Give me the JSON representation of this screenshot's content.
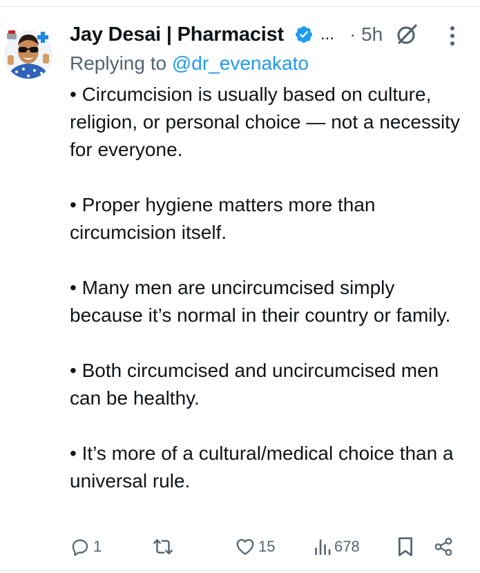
{
  "tweet": {
    "author_name": "Jay Desai | Pharmacist",
    "name_overflow": "...",
    "timestamp": "· 5h",
    "replying_prefix": "Replying to ",
    "replying_handle": "@dr_evenakato",
    "paragraphs": [
      "• Circumcision is usually based on culture, religion, or personal choice — not a necessity for everyone.",
      "• Proper hygiene matters more than circumcision itself.",
      "• Many men are uncircumcised simply because it’s normal in their country or family.",
      "• Both circumcised and uncircumcised men can be healthy.",
      "• It’s more of a cultural/medical choice than a universal rule."
    ]
  },
  "actions": {
    "reply_count": "1",
    "like_count": "15",
    "views_count": "678"
  },
  "icons": {
    "verified": "verified-badge-icon",
    "grok": "grok-icon",
    "more": "more-vertical-icon",
    "reply": "reply-icon",
    "retweet": "retweet-icon",
    "like": "heart-icon",
    "views": "views-icon",
    "bookmark": "bookmark-icon",
    "share": "share-icon"
  },
  "colors": {
    "text": "#0f1419",
    "secondary": "#536471",
    "accent": "#1d9bf0"
  }
}
